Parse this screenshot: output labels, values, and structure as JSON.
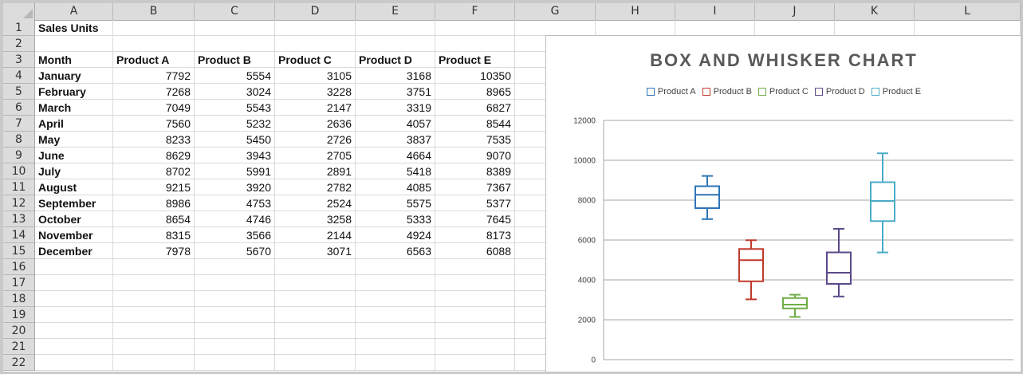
{
  "columns": [
    "A",
    "B",
    "C",
    "D",
    "E",
    "F",
    "G",
    "H",
    "I",
    "J",
    "K",
    "L"
  ],
  "rows": [
    "1",
    "2",
    "3",
    "4",
    "5",
    "6",
    "7",
    "8",
    "9",
    "10",
    "11",
    "12",
    "13",
    "14",
    "15",
    "16",
    "17",
    "18",
    "19",
    "20",
    "21",
    "22"
  ],
  "sheet": {
    "title": "Sales Units",
    "header": [
      "Month",
      "Product A",
      "Product B",
      "Product C",
      "Product D",
      "Product E"
    ],
    "data": [
      [
        "January",
        "7792",
        "5554",
        "3105",
        "3168",
        "10350"
      ],
      [
        "February",
        "7268",
        "3024",
        "3228",
        "3751",
        "8965"
      ],
      [
        "March",
        "7049",
        "5543",
        "2147",
        "3319",
        "6827"
      ],
      [
        "April",
        "7560",
        "5232",
        "2636",
        "4057",
        "8544"
      ],
      [
        "May",
        "8233",
        "5450",
        "2726",
        "3837",
        "7535"
      ],
      [
        "June",
        "8629",
        "3943",
        "2705",
        "4664",
        "9070"
      ],
      [
        "July",
        "8702",
        "5991",
        "2891",
        "5418",
        "8389"
      ],
      [
        "August",
        "9215",
        "3920",
        "2782",
        "4085",
        "7367"
      ],
      [
        "September",
        "8986",
        "4753",
        "2524",
        "5575",
        "5377"
      ],
      [
        "October",
        "8654",
        "4746",
        "3258",
        "5333",
        "7645"
      ],
      [
        "November",
        "8315",
        "3566",
        "2144",
        "4924",
        "8173"
      ],
      [
        "December",
        "7978",
        "5670",
        "3071",
        "6563",
        "6088"
      ]
    ]
  },
  "chart_data": {
    "type": "box",
    "title": "BOX AND WHISKER CHART",
    "legend_position": "top",
    "grid": true,
    "ylim": [
      0,
      12000
    ],
    "yticks": [
      "0",
      "2000",
      "4000",
      "6000",
      "8000",
      "10000",
      "12000"
    ],
    "series": [
      {
        "name": "Product A",
        "color": "#2e75b6",
        "min": 7049,
        "q1": 7600,
        "median": 8270,
        "q3": 8700,
        "max": 9215
      },
      {
        "name": "Product B",
        "color": "#c0392b",
        "min": 3024,
        "q1": 3930,
        "median": 4990,
        "q3": 5550,
        "max": 5991
      },
      {
        "name": "Product C",
        "color": "#70ad47",
        "min": 2144,
        "q1": 2570,
        "median": 2760,
        "q3": 3090,
        "max": 3258
      },
      {
        "name": "Product D",
        "color": "#5b4a8b",
        "min": 3168,
        "q1": 3800,
        "median": 4360,
        "q3": 5380,
        "max": 6563
      },
      {
        "name": "Product E",
        "color": "#4bacc6",
        "min": 5377,
        "q1": 6950,
        "median": 7960,
        "q3": 8900,
        "max": 10350
      }
    ]
  }
}
